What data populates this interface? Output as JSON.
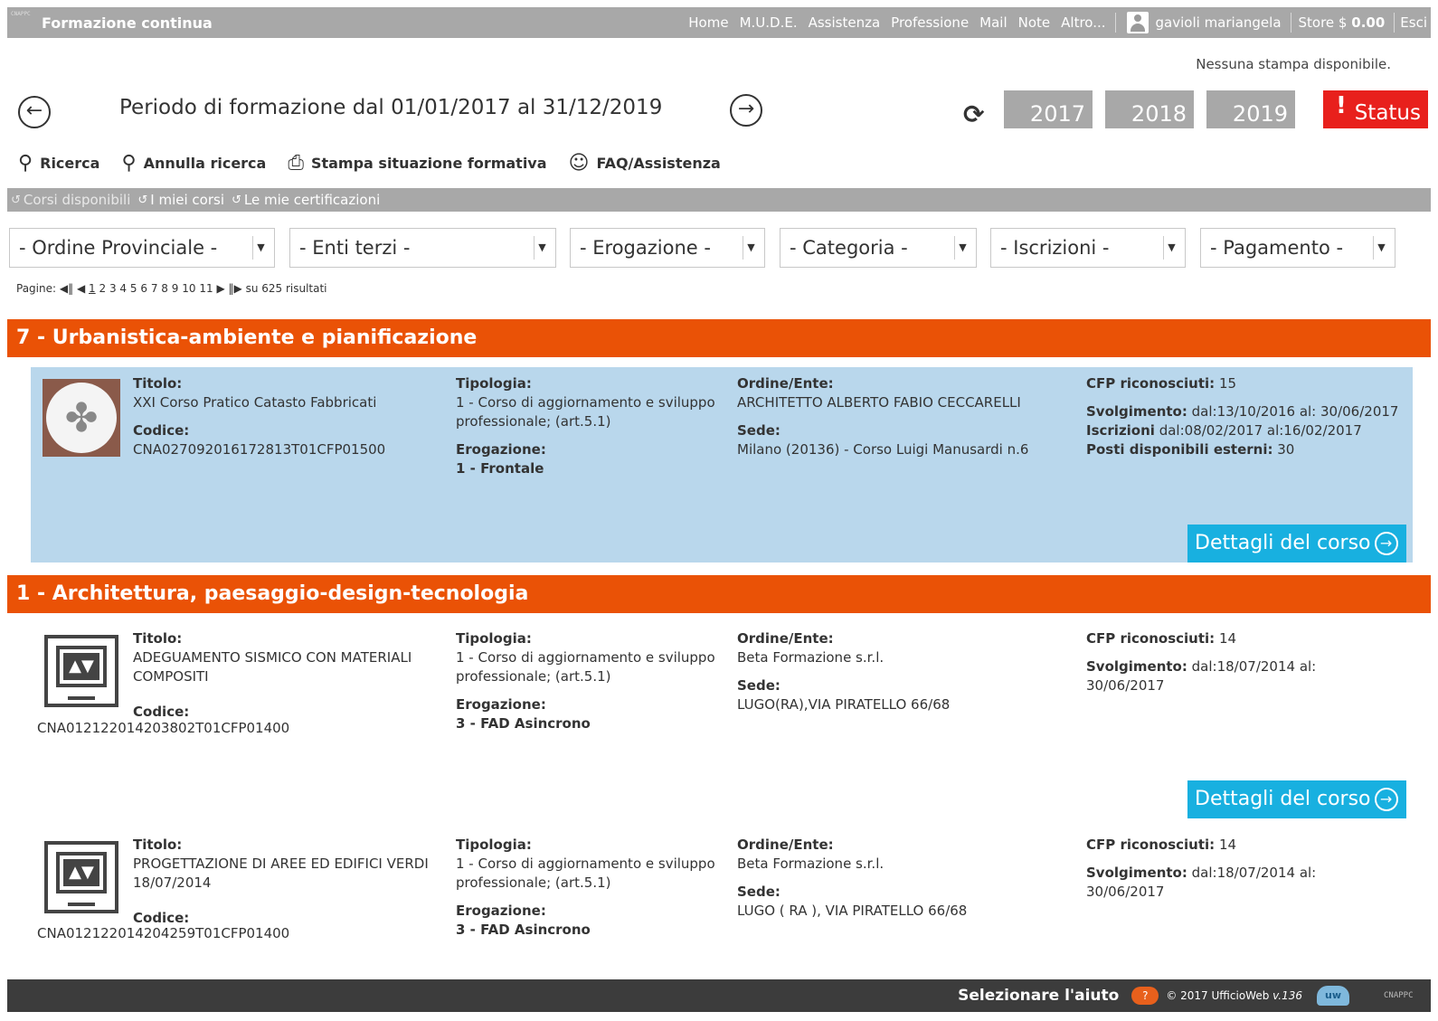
{
  "header": {
    "logo_text": "CNAPPC",
    "brand": "Formazione continua",
    "nav": [
      "Home",
      "M.U.D.E.",
      "Assistenza",
      "Professione",
      "Mail",
      "Note",
      "Altro..."
    ],
    "user": "gavioli mariangela",
    "store_label": "Store $",
    "store_value": "0.00",
    "exit": "Esci"
  },
  "no_print": "Nessuna stampa disponibile.",
  "period": {
    "prev_icon": "arrow-left-circle-icon",
    "label": "Periodo di formazione dal 01/01/2017 al 31/12/2019",
    "next_icon": "arrow-right-circle-icon",
    "years": [
      "2017",
      "2018",
      "2019"
    ],
    "status_label": "Status"
  },
  "toolbar": {
    "search": "Ricerca",
    "cancel_search": "Annulla ricerca",
    "print": "Stampa situazione formativa",
    "faq": "FAQ/Assistenza"
  },
  "tabs": [
    "Corsi disponibili",
    "I miei corsi",
    "Le mie certificazioni"
  ],
  "filters": [
    "- Ordine Provinciale -",
    "- Enti terzi -",
    "- Erogazione -",
    "- Categoria -",
    "- Iscrizioni -",
    "- Pagamento -"
  ],
  "pager": {
    "label": "Pagine:",
    "pages": [
      "1",
      "2",
      "3",
      "4",
      "5",
      "6",
      "7",
      "8",
      "9",
      "10",
      "11"
    ],
    "results": "su 625 risultati"
  },
  "labels": {
    "titolo": "Titolo:",
    "codice": "Codice:",
    "tipologia": "Tipologia:",
    "erogazione": "Erogazione:",
    "ordine": "Ordine/Ente:",
    "sede": "Sede:",
    "cfp": "CFP riconosciuti:",
    "svolgimento": "Svolgimento:",
    "iscrizioni": "Iscrizioni",
    "posti": "Posti disponibili esterni:",
    "details": "Dettagli del corso"
  },
  "categories": [
    "7 - Urbanistica-ambiente e pianificazione",
    "1 - Architettura, paesaggio-design-tecnologia"
  ],
  "courses": [
    {
      "titolo": "XXI Corso Pratico Catasto Fabbricati",
      "codice": "CNA027092016172813T01CFP01500",
      "tipologia": "1 - Corso di aggiornamento e sviluppo professionale; (art.5.1)",
      "erogazione": "1 - Frontale",
      "ordine": "ARCHITETTO ALBERTO FABIO CECCARELLI",
      "sede": "Milano (20136) - Corso Luigi Manusardi n.6",
      "cfp": "15",
      "svolgimento": "dal:13/10/2016 al: 30/06/2017",
      "iscrizioni": "dal:08/02/2017 al:16/02/2017",
      "posti": "30"
    },
    {
      "titolo": "ADEGUAMENTO SISMICO CON MATERIALI COMPOSITI",
      "codice": "CNA012122014203802T01CFP01400",
      "tipologia": "1 - Corso di aggiornamento e sviluppo professionale; (art.5.1)",
      "erogazione": "3 - FAD Asincrono",
      "ordine": "Beta Formazione s.r.l.",
      "sede": "LUGO(RA),VIA PIRATELLO 66/68",
      "cfp": "14",
      "svolgimento": "dal:18/07/2014 al: 30/06/2017"
    },
    {
      "titolo": "PROGETTAZIONE DI AREE ED EDIFICI VERDI 18/07/2014",
      "codice": "CNA012122014204259T01CFP01400",
      "tipologia": "1 - Corso di aggiornamento e sviluppo professionale; (art.5.1)",
      "erogazione": "3 - FAD Asincrono",
      "ordine": "Beta Formazione s.r.l.",
      "sede": "LUGO ( RA ), VIA PIRATELLO 66/68",
      "cfp": "14",
      "svolgimento": "dal:18/07/2014 al: 30/06/2017"
    }
  ],
  "footer": {
    "help": "Selezionare l'aiuto",
    "copyright": "© 2017 UfficioWeb",
    "version": "v.136",
    "logo_text": "CNAPPC"
  },
  "colors": {
    "topbar": "#a8a8a8",
    "category": "#ea5206",
    "highlight": "#b9d7ec",
    "details_button": "#18b0e0",
    "status": "#e8201c",
    "footer": "#3c3c3c"
  }
}
